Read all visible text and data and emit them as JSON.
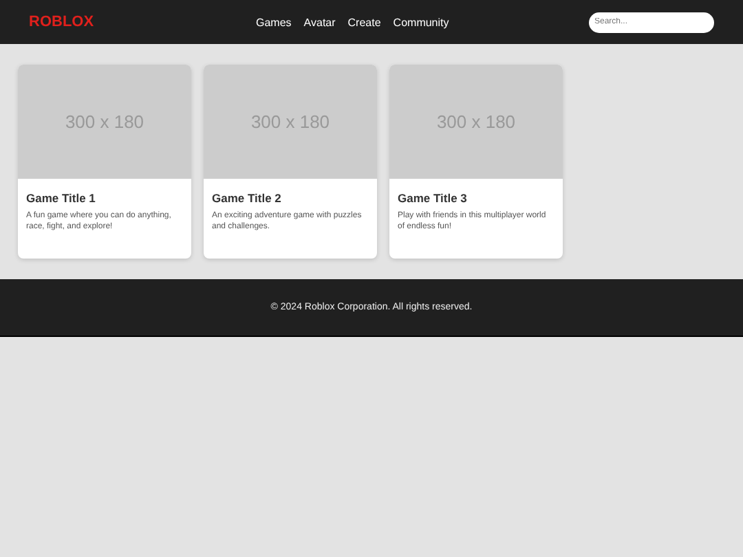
{
  "header": {
    "logo": "ROBLOX",
    "nav": [
      "Games",
      "Avatar",
      "Create",
      "Community"
    ],
    "search": {
      "placeholder": "Search..."
    }
  },
  "games": [
    {
      "image_label": "300 x 180",
      "title": "Game Title 1",
      "description": "A fun game where you can do anything, race, fight, and explore!"
    },
    {
      "image_label": "300 x 180",
      "title": "Game Title 2",
      "description": "An exciting adventure game with puzzles and challenges."
    },
    {
      "image_label": "300 x 180",
      "title": "Game Title 3",
      "description": "Play with friends in this multiplayer world of endless fun!"
    }
  ],
  "footer": "© 2024 Roblox Corporation. All rights reserved."
}
